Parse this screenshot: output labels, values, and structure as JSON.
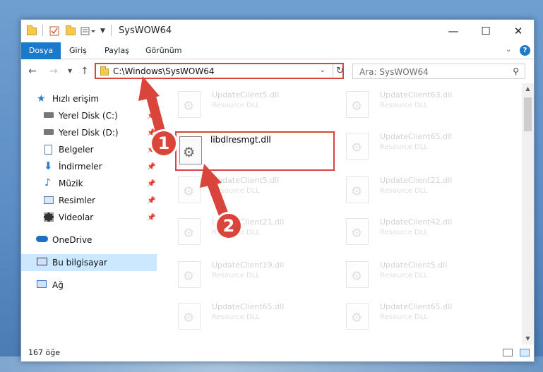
{
  "window": {
    "title": "SysWOW64"
  },
  "window_controls": {
    "minimize": "—",
    "maximize": "☐",
    "close": "✕"
  },
  "ribbon": {
    "tabs": [
      "Dosya",
      "Giriş",
      "Paylaş",
      "Görünüm"
    ]
  },
  "address": {
    "path": "C:\\Windows\\SysWOW64"
  },
  "search": {
    "placeholder": "Ara: SysWOW64"
  },
  "sidebar": {
    "items": [
      {
        "label": "Hızlı erişim"
      },
      {
        "label": "Yerel Disk (C:)"
      },
      {
        "label": "Yerel Disk (D:)"
      },
      {
        "label": "Belgeler"
      },
      {
        "label": "İndirmeler"
      },
      {
        "label": "Müzik"
      },
      {
        "label": "Resimler"
      },
      {
        "label": "Videolar"
      },
      {
        "label": "OneDrive"
      },
      {
        "label": "Bu bilgisayar"
      },
      {
        "label": "Ağ"
      }
    ]
  },
  "files": [
    {
      "name": "UpdateClient5.dll",
      "type": "Resource DLL"
    },
    {
      "name": "UpdateClient63.dll",
      "type": "Resource DLL"
    },
    {
      "name": "UpdateClient65.dll",
      "type": "Resource DLL"
    },
    {
      "name": "UpdateClient5.dll",
      "type": "Resource DLL"
    },
    {
      "name": "UpdateClient21.dll",
      "type": "Resource DLL"
    },
    {
      "name": "UpdateClient21.dll",
      "type": "Resource DLL"
    },
    {
      "name": "UpdateClient42.dll",
      "type": "Resource DLL"
    },
    {
      "name": "UpdateClient19.dll",
      "type": "Resource DLL"
    },
    {
      "name": "UpdateClient5.dll",
      "type": "Resource DLL"
    },
    {
      "name": "UpdateClient65.dll",
      "type": "Resource DLL"
    },
    {
      "name": "UpdateClient65.dll",
      "type": "Resource DLL"
    }
  ],
  "highlighted_file": {
    "name": "libdlresmgt.dll"
  },
  "annotations": {
    "badge1": "1",
    "badge2": "2"
  },
  "status": {
    "count": "167 öğe"
  },
  "colors": {
    "accent": "#1979ca",
    "highlight": "#d9443b",
    "selected": "#cce8ff"
  }
}
